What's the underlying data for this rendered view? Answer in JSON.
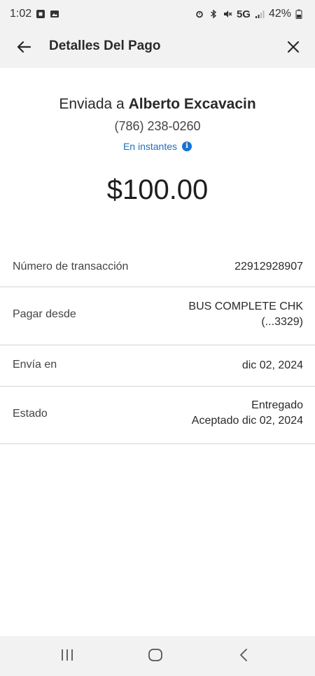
{
  "status_bar": {
    "time": "1:02",
    "network": "5G",
    "battery": "42%"
  },
  "header": {
    "title": "Detalles Del Pago",
    "back_icon": "arrow-left-icon",
    "close_icon": "close-icon"
  },
  "summary": {
    "sent_prefix": "Enviada a",
    "recipient_name": "Alberto Excavacin",
    "recipient_phone": "(786) 238-0260",
    "speed_label": "En instantes",
    "amount": "$100.00"
  },
  "details": [
    {
      "label": "Número de transacción",
      "value_lines": [
        "22912928907"
      ]
    },
    {
      "label": "Pagar desde",
      "value_lines": [
        "BUS COMPLETE CHK",
        "(...3329)"
      ]
    },
    {
      "label": "Envía en",
      "value_lines": [
        "dic 02, 2024"
      ]
    },
    {
      "label": "Estado",
      "value_lines": [
        "Entregado",
        "Aceptado dic 02, 2024"
      ]
    }
  ],
  "colors": {
    "accent_blue": "#1a73d1",
    "header_bg": "#f2f2f2",
    "divider": "#d4d4d4"
  }
}
